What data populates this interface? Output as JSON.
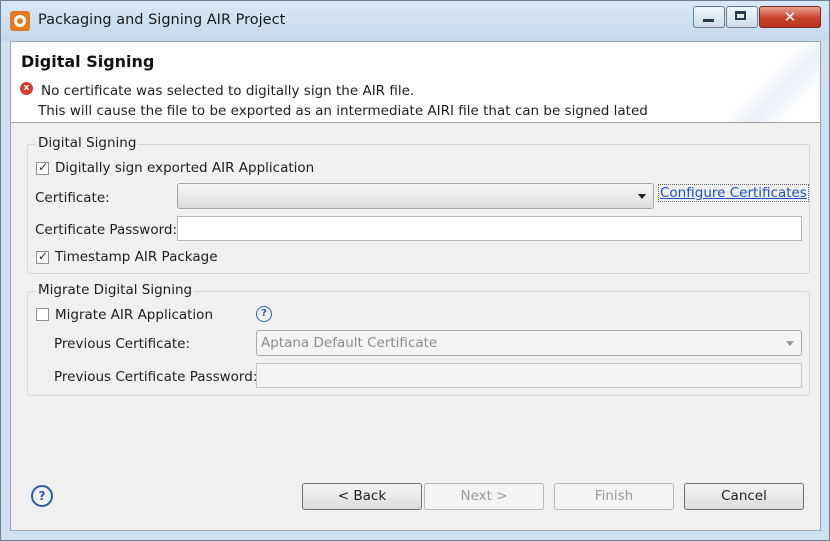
{
  "window": {
    "title": "Packaging and Signing AIR Project",
    "close_glyph": "✕"
  },
  "header": {
    "page_title": "Digital Signing",
    "error_line1": "No certificate was selected to digitally sign the AIR file.",
    "error_line2": "This will cause the file to be exported as an intermediate AIRI file that can be signed lated"
  },
  "digital_signing": {
    "group_label": "Digital Signing",
    "sign_checkbox_label": "Digitally sign exported AIR Application",
    "sign_checked": true,
    "certificate_label": "Certificate:",
    "certificate_value": "",
    "configure_link": "Configure Certificates",
    "password_label": "Certificate Password:",
    "password_value": "",
    "timestamp_label": "Timestamp AIR Package",
    "timestamp_checked": true
  },
  "migrate": {
    "group_label": "Migrate Digital Signing",
    "migrate_checkbox_label": "Migrate AIR Application",
    "migrate_checked": false,
    "help_glyph": "?",
    "previous_certificate_label": "Previous Certificate:",
    "previous_certificate_value": "Aptana Default Certificate",
    "previous_password_label": "Previous Certificate Password:",
    "previous_password_value": ""
  },
  "footer": {
    "help_glyph": "?",
    "back_label": "< Back",
    "next_label": "Next >",
    "finish_label": "Finish",
    "cancel_label": "Cancel"
  },
  "colors": {
    "title_bar": "#c4d8ee",
    "close_button": "#c7432b",
    "error_icon": "#d63c2f",
    "link": "#1a4fc4"
  }
}
